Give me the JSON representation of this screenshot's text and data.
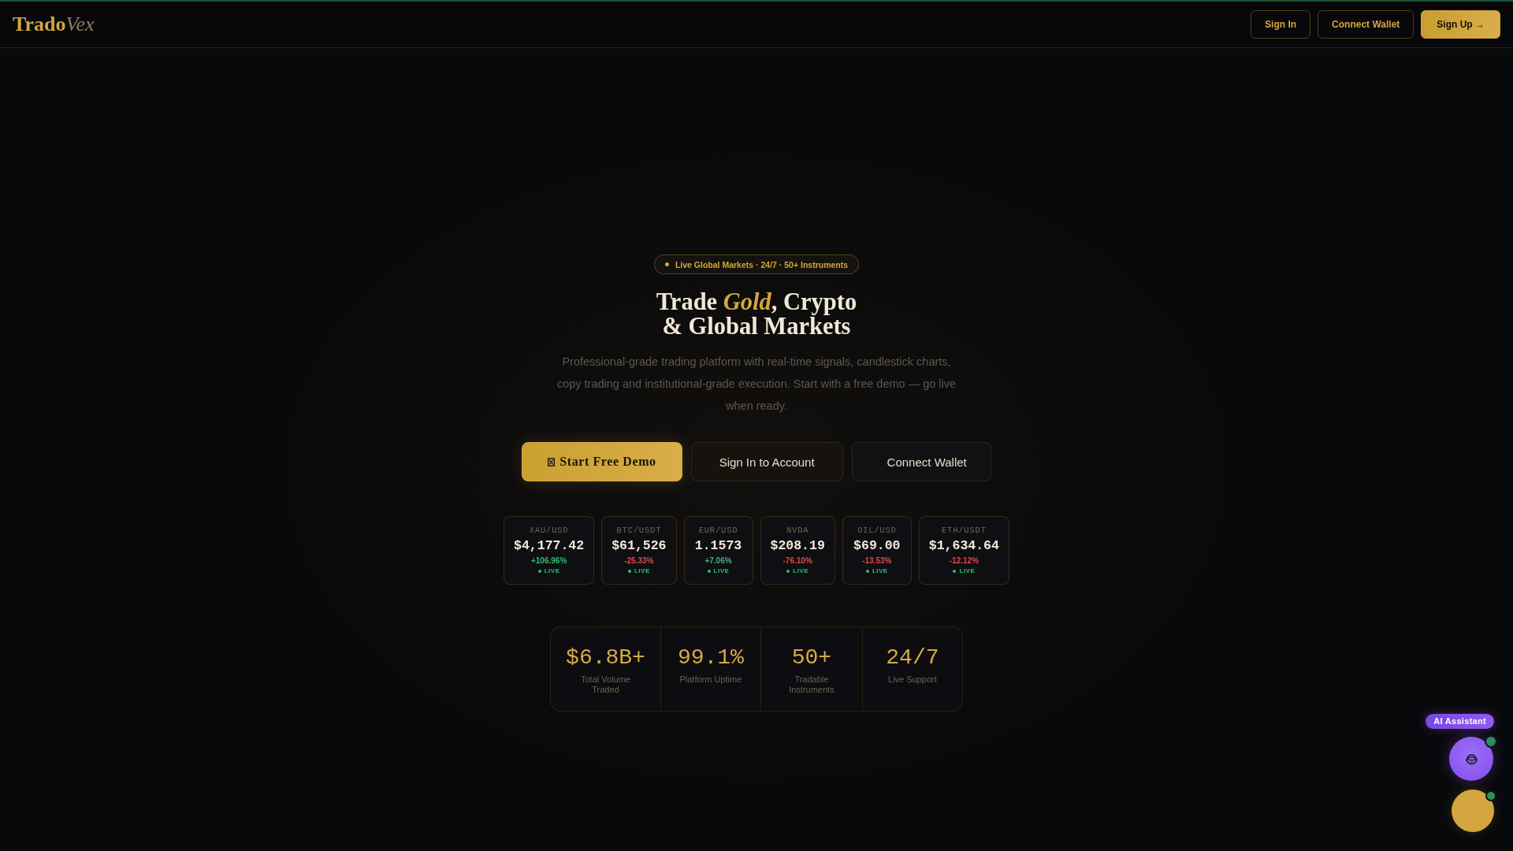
{
  "header": {
    "logo": {
      "primary": "Trado",
      "secondary": "Vex"
    },
    "buttons": [
      {
        "label": "Sign In",
        "kind": "outline"
      },
      {
        "label": "Connect Wallet",
        "kind": "outline"
      },
      {
        "label": "Sign Up →",
        "kind": "primary"
      }
    ]
  },
  "hero": {
    "badge": "Live Global Markets · 24/7 · 50+ Instruments",
    "title_lines": [
      "Trade *Gold*, Crypto",
      "& Global Markets"
    ],
    "description": "Professional-grade trading platform with real-time signals, candlestick charts, copy trading and institutional-grade execution. Start with a free demo — go live when ready.",
    "actions": [
      {
        "label": "Start Free Demo",
        "kind": "primary"
      },
      {
        "label": "Sign In to Account",
        "kind": "secondary"
      },
      {
        "label": "Connect Wallet",
        "kind": "ghost"
      }
    ]
  },
  "tickers": [
    {
      "symbol": "XAU/USD",
      "price": "$4,177.42",
      "change": "+106.96%",
      "rising": true,
      "status": "LIVE"
    },
    {
      "symbol": "BTC/USDT",
      "price": "$61,526",
      "change": "-25.33%",
      "rising": false,
      "status": "LIVE"
    },
    {
      "symbol": "EUR/USD",
      "price": "1.1573",
      "change": "+7.06%",
      "rising": true,
      "status": "LIVE"
    },
    {
      "symbol": "NVDA",
      "price": "$208.19",
      "change": "-76.10%",
      "rising": false,
      "status": "LIVE"
    },
    {
      "symbol": "OIL/USD",
      "price": "$69.00",
      "change": "-13.53%",
      "rising": false,
      "status": "LIVE"
    },
    {
      "symbol": "ETH/USDT",
      "price": "$1,634.64",
      "change": "-12.12%",
      "rising": false,
      "status": "LIVE"
    }
  ],
  "stats": [
    {
      "value": "$6.8B+",
      "label": "Total Volume Traded"
    },
    {
      "value": "99.1%",
      "label": "Platform Uptime"
    },
    {
      "value": "50+",
      "label": "Tradable Instruments"
    },
    {
      "value": "24/7",
      "label": "Live Support"
    }
  ],
  "floating_buttons": [
    {
      "kind": "assistant",
      "label": "AI Assistant",
      "online": true
    },
    {
      "kind": "chat",
      "online": true
    }
  ]
}
